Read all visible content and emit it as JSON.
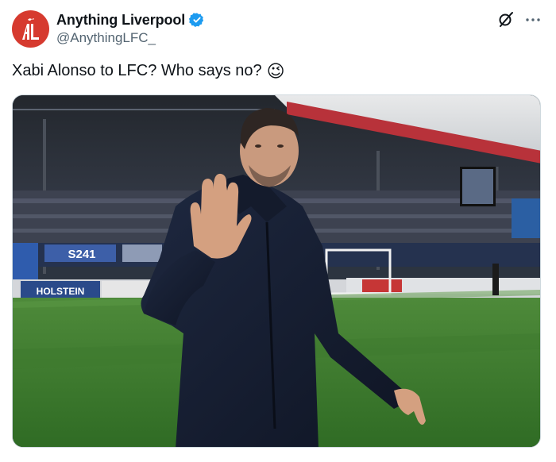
{
  "tweet": {
    "display_name": "Anything Liverpool",
    "handle": "@AnythingLFC_",
    "text": "Xabi Alonso to LFC? Who says no?",
    "emoji": "😉",
    "avatar_icon": "anything-liverpool-logo",
    "verified_icon": "verified-badge-icon",
    "verified_color": "#1d9bf0",
    "avatar_color": "#d63a2f",
    "actions": {
      "grok_icon": "grok-icon",
      "more_icon": "more-options-icon"
    },
    "media": {
      "description_icon": "stadium-photo",
      "ad_boards": [
        "S241",
        "HOLSTEIN"
      ]
    }
  }
}
